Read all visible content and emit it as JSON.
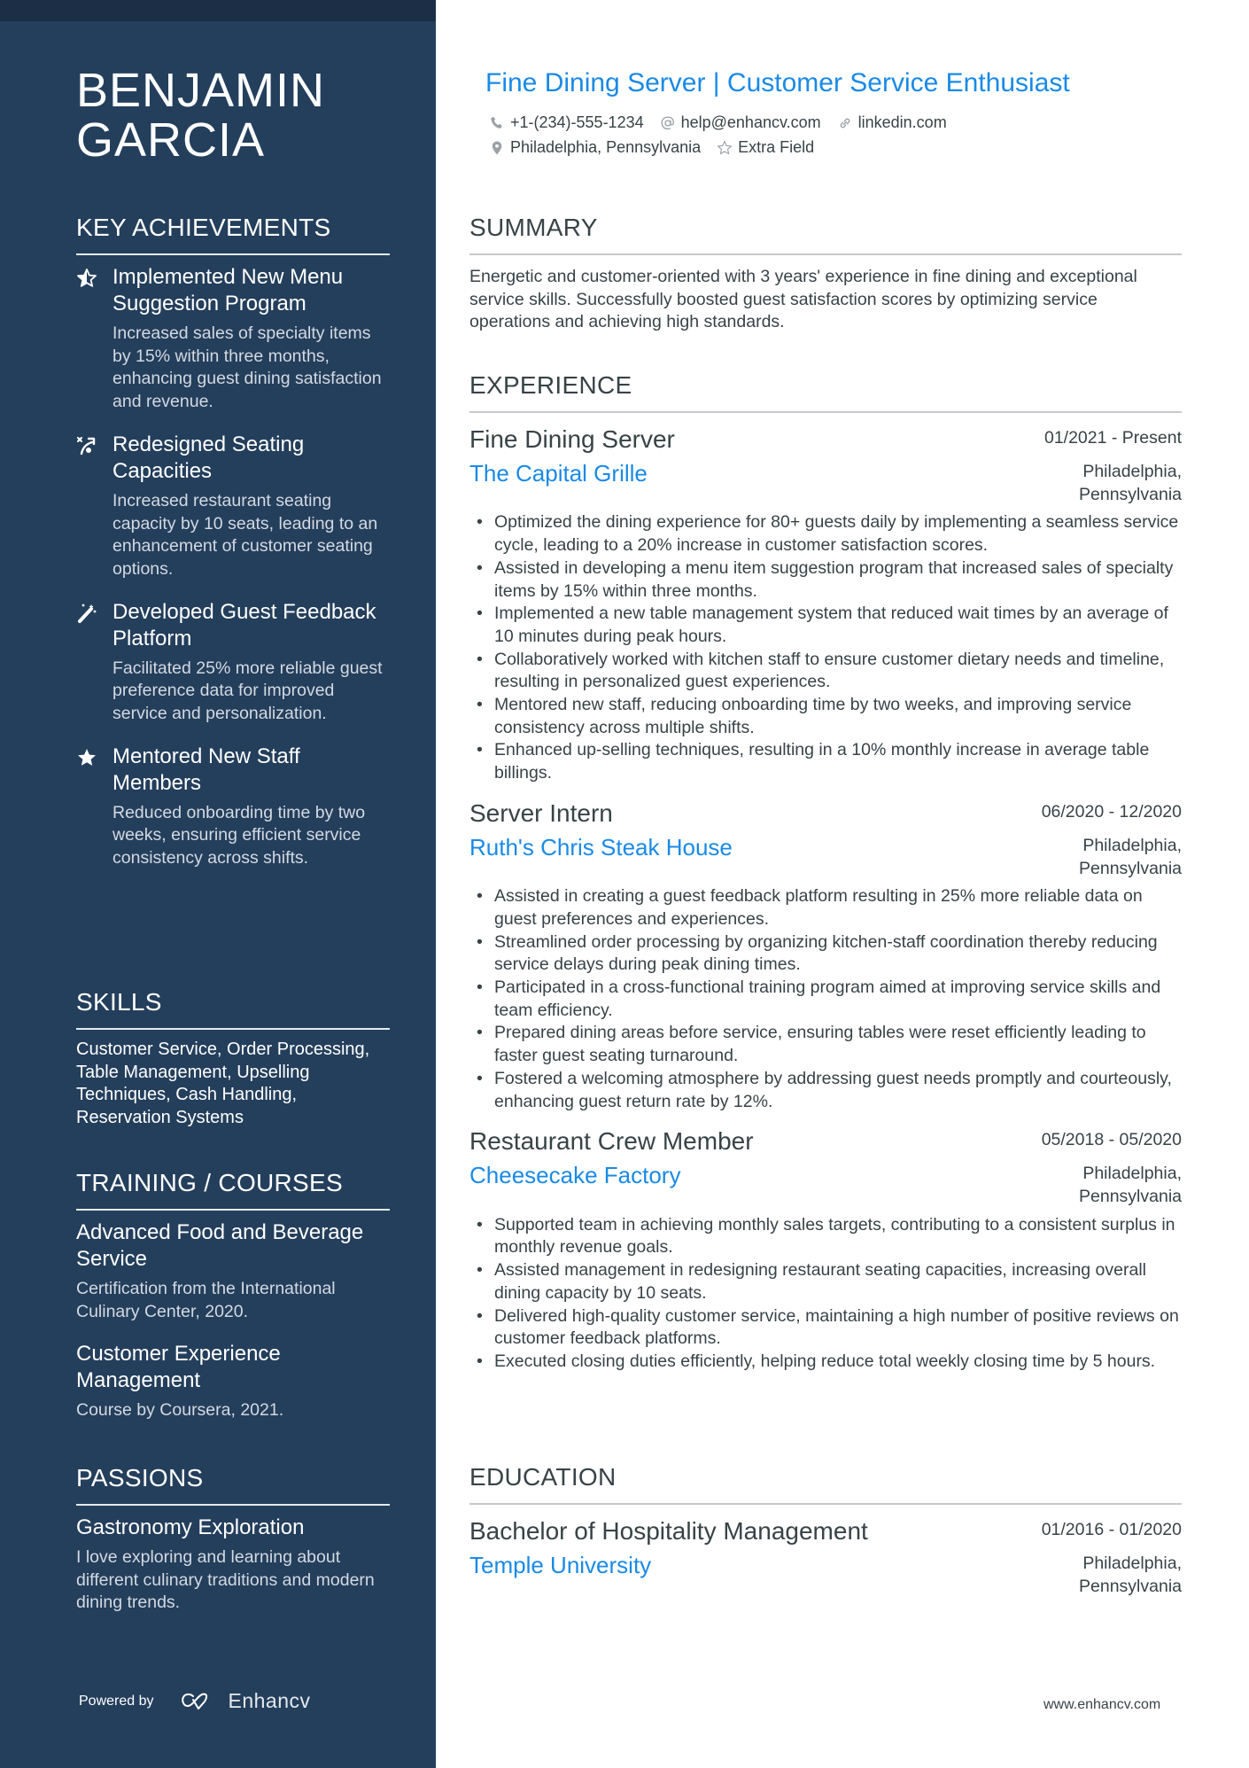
{
  "sidebar": {
    "name_line1": "BENJAMIN",
    "name_line2": "GARCIA",
    "achievements": {
      "heading": "KEY ACHIEVEMENTS",
      "items": [
        {
          "icon": "half-star-icon",
          "title": "Implemented New Menu Suggestion Program",
          "desc": "Increased sales of specialty items by 15% within three months, enhancing guest dining satisfaction and revenue."
        },
        {
          "icon": "strategy-arrow-icon",
          "title": "Redesigned Seating Capacities",
          "desc": "Increased restaurant seating capacity by 10 seats, leading to an enhancement of customer seating options."
        },
        {
          "icon": "magic-wand-icon",
          "title": "Developed Guest Feedback Platform",
          "desc": "Facilitated 25% more reliable guest preference data for improved service and personalization."
        },
        {
          "icon": "star-icon",
          "title": "Mentored New Staff Members",
          "desc": "Reduced onboarding time by two weeks, ensuring efficient service consistency across shifts."
        }
      ]
    },
    "skills": {
      "heading": "SKILLS",
      "text": "Customer Service, Order Processing, Table Management, Upselling Techniques, Cash Handling, Reservation Systems"
    },
    "training": {
      "heading": "TRAINING / COURSES",
      "items": [
        {
          "title": "Advanced Food and Beverage Service",
          "desc": "Certification from the International Culinary Center, 2020."
        },
        {
          "title": "Customer Experience Management",
          "desc": "Course by Coursera, 2021."
        }
      ]
    },
    "passions": {
      "heading": "PASSIONS",
      "items": [
        {
          "title": "Gastronomy Exploration",
          "desc": "I love exploring and learning about different culinary traditions and modern dining trends."
        }
      ]
    },
    "footer": {
      "powered_by": "Powered by",
      "brand": "Enhancv"
    }
  },
  "header": {
    "title": "Fine Dining Server | Customer Service Enthusiast",
    "contacts": {
      "phone": "+1-(234)-555-1234",
      "email": "help@enhancv.com",
      "link": "linkedin.com",
      "location": "Philadelphia, Pennsylvania",
      "extra": "Extra Field"
    }
  },
  "summary": {
    "heading": "SUMMARY",
    "text": "Energetic and customer-oriented with 3 years' experience in fine dining and exceptional service skills. Successfully boosted guest satisfaction scores by optimizing service operations and achieving high standards."
  },
  "experience": {
    "heading": "EXPERIENCE",
    "jobs": [
      {
        "title": "Fine Dining Server",
        "dates": "01/2021 - Present",
        "company": "The Capital Grille",
        "location_line1": "Philadelphia,",
        "location_line2": "Pennsylvania",
        "bullets": [
          "Optimized the dining experience for 80+ guests daily by implementing a seamless service cycle, leading to a 20% increase in customer satisfaction scores.",
          "Assisted in developing a menu item suggestion program that increased sales of specialty items by 15% within three months.",
          "Implemented a new table management system that reduced wait times by an average of 10 minutes during peak hours.",
          "Collaboratively worked with kitchen staff to ensure customer dietary needs and timeline, resulting in personalized guest experiences.",
          "Mentored new staff, reducing onboarding time by two weeks, and improving service consistency across multiple shifts.",
          "Enhanced up-selling techniques, resulting in a 10% monthly increase in average table billings."
        ]
      },
      {
        "title": "Server Intern",
        "dates": "06/2020 - 12/2020",
        "company": "Ruth's Chris Steak House",
        "location_line1": "Philadelphia,",
        "location_line2": "Pennsylvania",
        "bullets": [
          "Assisted in creating a guest feedback platform resulting in 25% more reliable data on guest preferences and experiences.",
          "Streamlined order processing by organizing kitchen-staff coordination thereby reducing service delays during peak dining times.",
          "Participated in a cross-functional training program aimed at improving service skills and team efficiency.",
          "Prepared dining areas before service, ensuring tables were reset efficiently leading to faster guest seating turnaround.",
          "Fostered a welcoming atmosphere by addressing guest needs promptly and courteously, enhancing guest return rate by 12%."
        ]
      },
      {
        "title": "Restaurant Crew Member",
        "dates": "05/2018 - 05/2020",
        "company": "Cheesecake Factory",
        "location_line1": "Philadelphia,",
        "location_line2": "Pennsylvania",
        "bullets": [
          "Supported team in achieving monthly sales targets, contributing to a consistent surplus in monthly revenue goals.",
          "Assisted management in redesigning restaurant seating capacities, increasing overall dining capacity by 10 seats.",
          "Delivered high-quality customer service, maintaining a high number of positive reviews on customer feedback platforms.",
          "Executed closing duties efficiently, helping reduce total weekly closing time by 5 hours."
        ]
      }
    ]
  },
  "education": {
    "heading": "EDUCATION",
    "items": [
      {
        "degree": "Bachelor of Hospitality Management",
        "dates": "01/2016 - 01/2020",
        "school": "Temple University",
        "location_line1": "Philadelphia,",
        "location_line2": "Pennsylvania"
      }
    ]
  },
  "footer": {
    "url": "www.enhancv.com"
  },
  "colors": {
    "sidebar_bg": "#243f5c",
    "sidebar_strip": "#1b2e45",
    "accent_blue": "#1a8ae5",
    "text_dark": "#384347"
  }
}
